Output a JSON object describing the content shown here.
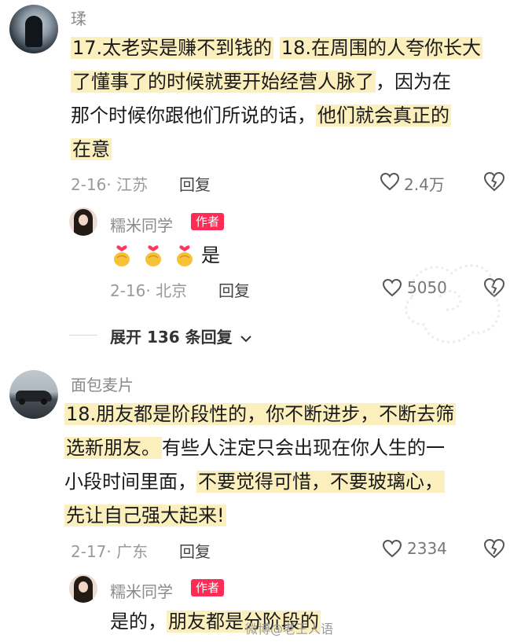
{
  "comments": [
    {
      "username": "瑈",
      "lines": [
        [
          {
            "t": "17.太老实是赚不到钱的",
            "h": true
          },
          {
            "t": " ",
            "h": false
          },
          {
            "t": "18.在周围的人夸你长大",
            "h": true
          }
        ],
        [
          {
            "t": "了懂事了的时候就要开始经营人脉了",
            "h": true
          },
          {
            "t": "，因为在",
            "h": false
          }
        ],
        [
          {
            "t": "那个时候你跟他们所说的话，",
            "h": false
          },
          {
            "t": "他们就会真正的",
            "h": true
          }
        ],
        [
          {
            "t": "在意",
            "h": true
          }
        ]
      ],
      "date_location": "2-16· 江苏",
      "reply_label": "回复",
      "like_count": "2.4万",
      "reply": {
        "username": "糯米同学",
        "author_tag": "作者",
        "text": "是",
        "date_location": "2-16· 北京",
        "reply_label": "回复",
        "like_count": "5050"
      },
      "expand_label": "展开 136 条回复"
    },
    {
      "username": "面包麦片",
      "lines": [
        [
          {
            "t": "18.朋友都是阶段性的，你不断进步，不断去筛",
            "h": true
          }
        ],
        [
          {
            "t": "选新朋友。",
            "h": true
          },
          {
            "t": "有些人注定只会出现在你人生的一",
            "h": false
          }
        ],
        [
          {
            "t": "小段时间里面，",
            "h": false
          },
          {
            "t": "不要觉得可惜，不要玻璃心，",
            "h": true
          }
        ],
        [
          {
            "t": "先让自己强大起来!",
            "h": true
          }
        ]
      ],
      "date_location": "2-17· 广东",
      "reply_label": "回复",
      "like_count": "2334",
      "reply": {
        "username": "糯米同学",
        "author_tag": "作者",
        "text_parts": [
          {
            "t": "是的，",
            "h": false
          },
          {
            "t": "朋友都是分阶段的",
            "h": true
          }
        ]
      }
    }
  ],
  "watermark": "微博@老王人语",
  "colors": {
    "highlight": "#fbefbe",
    "author_tag": "#fe2c55",
    "meta": "#9a9a9a"
  }
}
